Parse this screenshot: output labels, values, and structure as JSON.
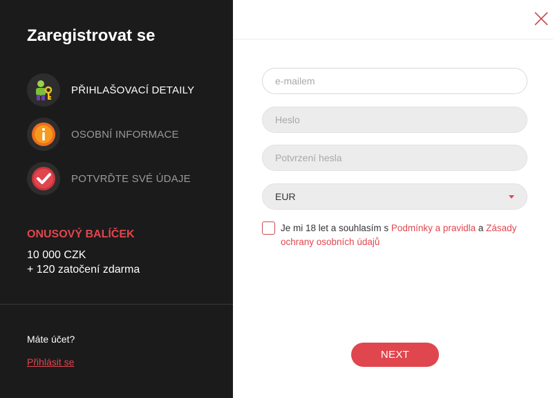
{
  "sidebar": {
    "title": "Zaregistrovat se",
    "steps": [
      {
        "label": "PŘIHLAŠOVACÍ DETAILY",
        "icon": "user-key-icon",
        "active": true
      },
      {
        "label": "OSOBNÍ INFORMACE",
        "icon": "info-icon",
        "active": false
      },
      {
        "label": "POTVRĎTE SVÉ ÚDAJE",
        "icon": "checkmark-icon",
        "active": false
      }
    ],
    "bonus": {
      "title": "ONUSOVÝ BALÍČEK",
      "line1": "10 000 CZK",
      "line2": "+ 120 zatočení zdarma"
    },
    "have_account": "Máte účet?",
    "login_link": "Přihlásit se"
  },
  "form": {
    "email_placeholder": "e-mailem",
    "password_placeholder": "Heslo",
    "confirm_placeholder": "Potvrzení hesla",
    "currency_value": "EUR",
    "consent": {
      "prefix": "Je mi 18 let a souhlasím s ",
      "terms_link": "Podmínky a pravidla",
      "middle": " a ",
      "privacy_link": "Zásady ochrany osobních údajů"
    },
    "next_label": "NEXT"
  },
  "colors": {
    "accent": "#e0464e",
    "sidebar_bg": "#1b1b1b",
    "field_bg": "#ececec"
  }
}
